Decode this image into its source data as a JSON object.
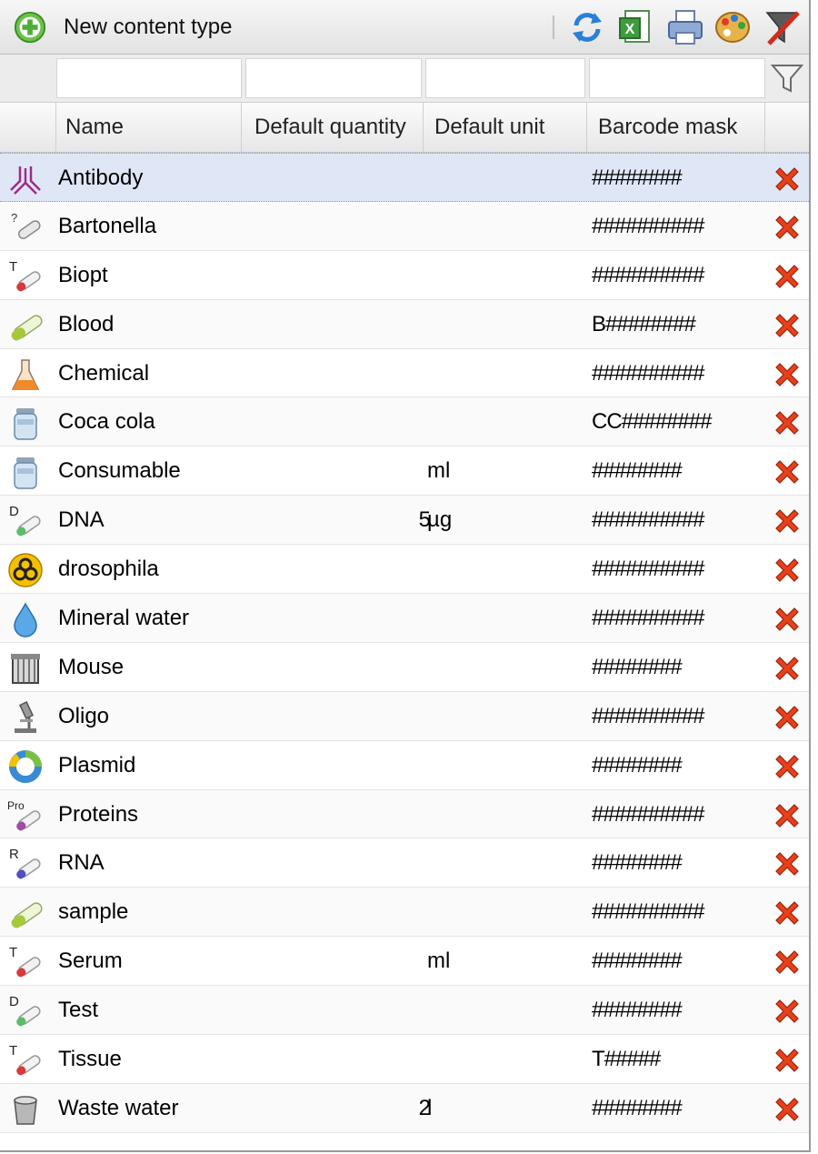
{
  "toolbar": {
    "new_label": "New content type",
    "icons": [
      "add-icon",
      "refresh-icon",
      "excel-export-icon",
      "print-icon",
      "palette-icon",
      "clear-filter-icon"
    ]
  },
  "filter": {
    "placeholder": ""
  },
  "columns": {
    "name": "Name",
    "quantity": "Default quantity",
    "unit": "Default unit",
    "mask": "Barcode mask"
  },
  "rows": [
    {
      "name": "Antibody",
      "qty": "",
      "unit": "",
      "mask": "########",
      "icon": "antibody-icon",
      "selected": true
    },
    {
      "name": "Bartonella",
      "qty": "",
      "unit": "",
      "mask": "##########",
      "icon": "tube-question-icon"
    },
    {
      "name": "Biopt",
      "qty": "",
      "unit": "",
      "mask": "##########",
      "icon": "tube-t-red-icon"
    },
    {
      "name": "Blood",
      "qty": "",
      "unit": "",
      "mask": "B########",
      "icon": "tube-green-icon"
    },
    {
      "name": "Chemical",
      "qty": "",
      "unit": "",
      "mask": "##########",
      "icon": "flask-icon"
    },
    {
      "name": "Coca cola",
      "qty": "",
      "unit": "",
      "mask": "CC########",
      "icon": "jar-icon"
    },
    {
      "name": "Consumable",
      "qty": "",
      "unit": "ml",
      "mask": "########",
      "icon": "jar-icon"
    },
    {
      "name": "DNA",
      "qty": "5",
      "unit": "µg",
      "mask": "##########",
      "icon": "tube-d-green-icon"
    },
    {
      "name": "drosophila",
      "qty": "",
      "unit": "",
      "mask": "##########",
      "icon": "biohazard-icon"
    },
    {
      "name": "Mineral water",
      "qty": "",
      "unit": "",
      "mask": "##########",
      "icon": "water-drop-icon"
    },
    {
      "name": "Mouse",
      "qty": "",
      "unit": "",
      "mask": "########",
      "icon": "mouse-cage-icon"
    },
    {
      "name": "Oligo",
      "qty": "",
      "unit": "",
      "mask": "##########",
      "icon": "microscope-icon"
    },
    {
      "name": "Plasmid",
      "qty": "",
      "unit": "",
      "mask": "########",
      "icon": "plasmid-ring-icon"
    },
    {
      "name": "Proteins",
      "qty": "",
      "unit": "",
      "mask": "##########",
      "icon": "tube-pro-purple-icon"
    },
    {
      "name": "RNA",
      "qty": "",
      "unit": "",
      "mask": "########",
      "icon": "tube-r-blue-icon"
    },
    {
      "name": "sample",
      "qty": "",
      "unit": "",
      "mask": "##########",
      "icon": "tube-green-icon"
    },
    {
      "name": "Serum",
      "qty": "",
      "unit": "ml",
      "mask": "########",
      "icon": "tube-t-red-icon"
    },
    {
      "name": "Test",
      "qty": "",
      "unit": "",
      "mask": "########",
      "icon": "tube-d-green-icon"
    },
    {
      "name": "Tissue",
      "qty": "",
      "unit": "",
      "mask": "T#####",
      "icon": "tube-t-red-icon"
    },
    {
      "name": "Waste water",
      "qty": "2",
      "unit": "l",
      "mask": "########",
      "icon": "bucket-icon"
    }
  ],
  "colors": {
    "selected_row": "#dfe7f7",
    "delete_red": "#e8401c",
    "add_green": "#4fae3a"
  }
}
